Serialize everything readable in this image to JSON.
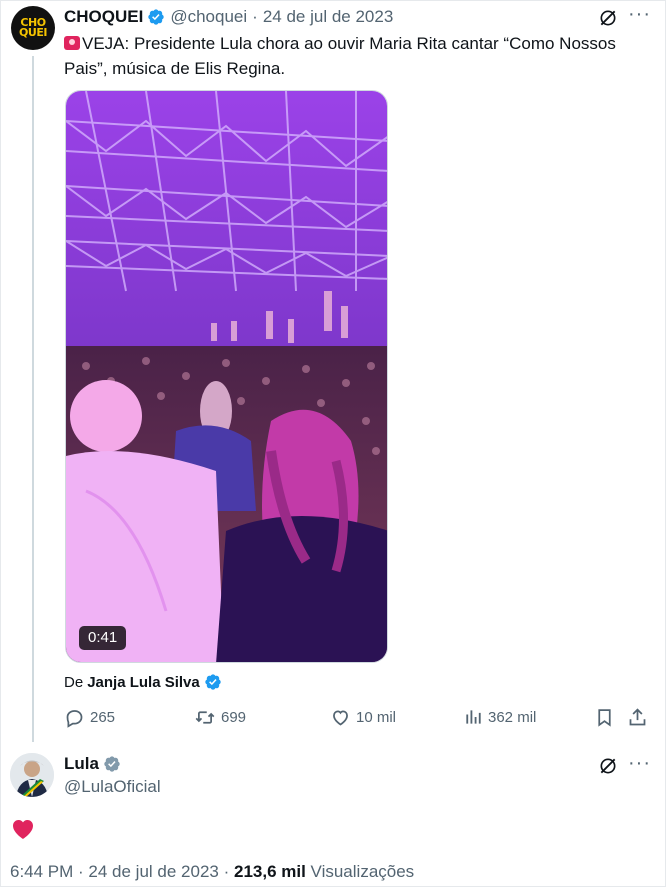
{
  "tweet": {
    "avatar_text": [
      "CHO",
      "QUEI"
    ],
    "author_name": "CHOQUEI",
    "author_handle": "@choquei",
    "separator": "·",
    "date": "24 de jul de 2023",
    "text": "VEJA: Presidente Lula chora ao ouvir Maria Rita cantar “Como Nossos Pais”, música de Elis Regina.",
    "video_duration": "0:41",
    "from_prefix": "De",
    "from_name": "Janja Lula Silva",
    "replies": "265",
    "retweets": "699",
    "likes": "10 mil",
    "views": "362 mil"
  },
  "reply": {
    "author_name": "Lula",
    "author_handle": "@LulaOficial",
    "footer_time": "6:44 PM · 24 de jul de 2023 ·",
    "footer_views": "213,6 mil",
    "footer_views_label": "Visualizações"
  },
  "icons": {
    "verified": "verified-badge-icon",
    "grok": "grok-icon",
    "more": "more-icon",
    "reply": "reply-icon",
    "retweet": "retweet-icon",
    "like": "like-icon",
    "views": "views-icon",
    "bookmark": "bookmark-icon",
    "share": "share-icon",
    "heart": "heart-icon",
    "siren": "siren-emoji-icon"
  },
  "colors": {
    "verified_blue": "#1d9bf0",
    "verified_gray": "#829aab",
    "heart_red": "#f91880",
    "secondary_text": "#536471",
    "avatar_yellow": "#f5c400"
  }
}
